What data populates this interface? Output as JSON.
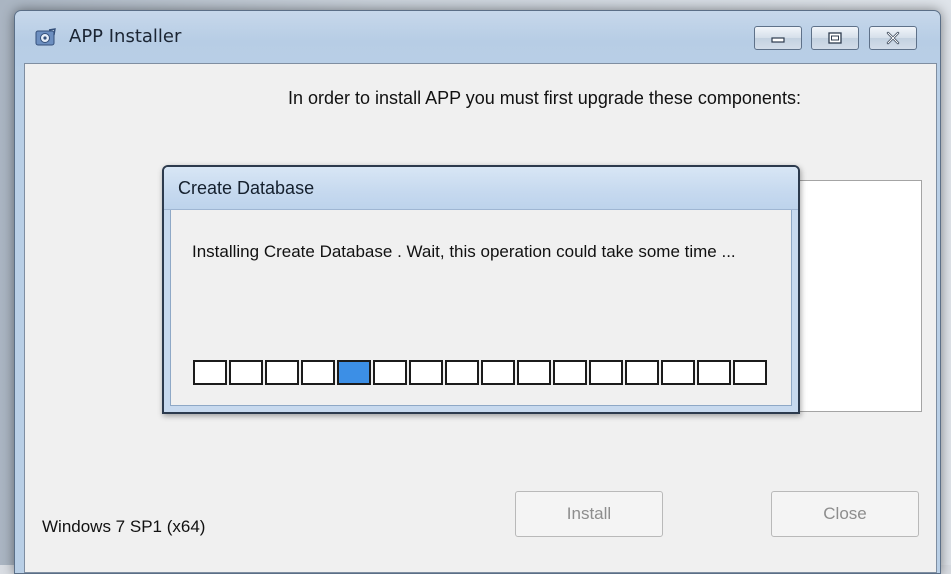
{
  "window": {
    "title": "APP Installer",
    "icon": "installer-app-icon",
    "controls": {
      "minimize_icon": "minimize-icon",
      "maximize_icon": "maximize-icon",
      "close_icon": "close-icon"
    }
  },
  "main": {
    "instruction": "In order to install APP you must first upgrade these components:",
    "os_label": "Windows 7 SP1 (x64)",
    "install_label": "Install",
    "close_label": "Close"
  },
  "dialog": {
    "title": "Create Database",
    "message": "Installing Create Database . Wait, this operation could take some time ...",
    "progress": {
      "segments": 16,
      "active_segment": 5
    }
  },
  "colors": {
    "progress_active": "#3c8fe6",
    "titlebar": "#b9cfe6"
  }
}
